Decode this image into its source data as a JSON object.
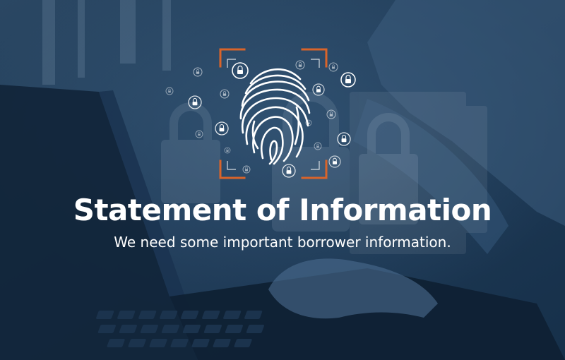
{
  "banner": {
    "title": "Statement of Information",
    "subtitle": "We need some important borrower information."
  },
  "icons": {
    "center": "fingerprint-icon",
    "frame": "scan-frame-corners",
    "orbit": "padlock-icon"
  },
  "colors": {
    "overlay": "#1f3a55",
    "accent": "#d9642a",
    "text": "#ffffff"
  }
}
